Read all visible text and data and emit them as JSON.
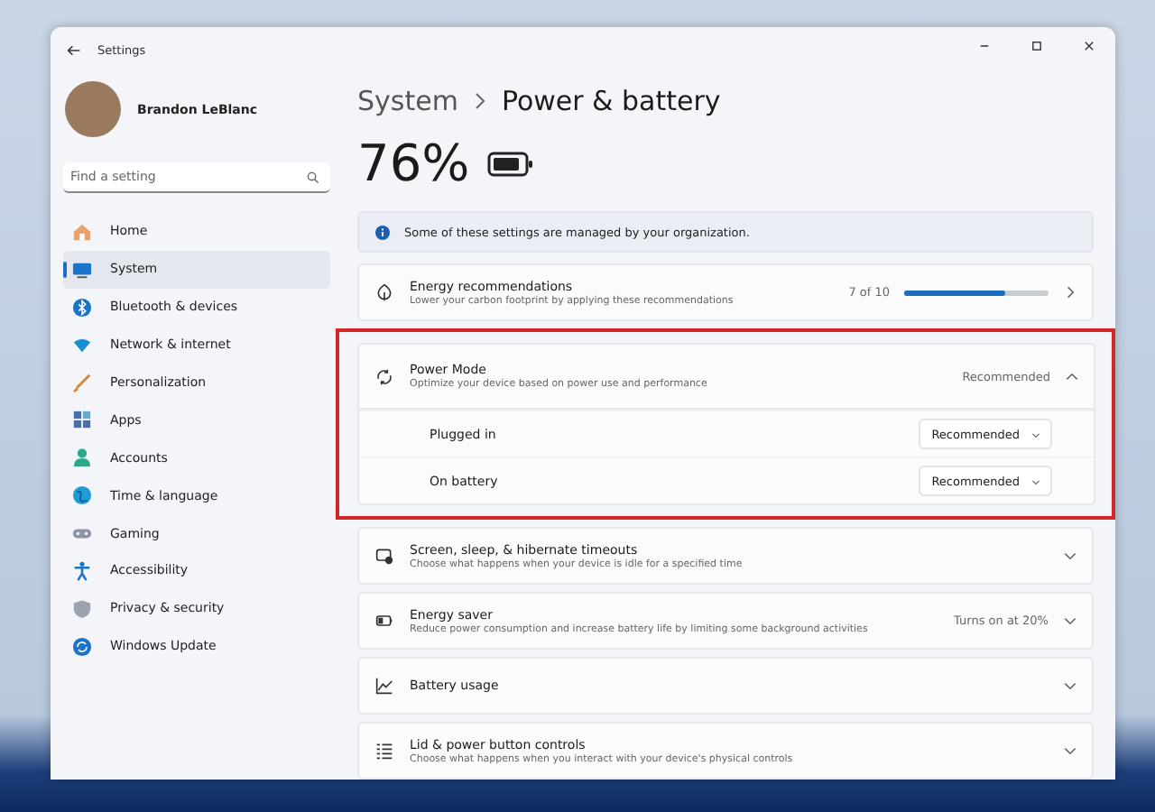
{
  "window": {
    "title": "Settings"
  },
  "user": {
    "name": "Brandon LeBlanc"
  },
  "search": {
    "placeholder": "Find a setting"
  },
  "nav": [
    {
      "label": "Home",
      "selected": false
    },
    {
      "label": "System",
      "selected": true
    },
    {
      "label": "Bluetooth & devices",
      "selected": false
    },
    {
      "label": "Network & internet",
      "selected": false
    },
    {
      "label": "Personalization",
      "selected": false
    },
    {
      "label": "Apps",
      "selected": false
    },
    {
      "label": "Accounts",
      "selected": false
    },
    {
      "label": "Time & language",
      "selected": false
    },
    {
      "label": "Gaming",
      "selected": false
    },
    {
      "label": "Accessibility",
      "selected": false
    },
    {
      "label": "Privacy & security",
      "selected": false
    },
    {
      "label": "Windows Update",
      "selected": false
    }
  ],
  "breadcrumb": {
    "parent": "System",
    "current": "Power & battery"
  },
  "battery": {
    "percent": "76%"
  },
  "notice": {
    "text": "Some of these settings are managed by your organization."
  },
  "settings": [
    {
      "kind": "progress",
      "title": "Energy recommendations",
      "subtitle": "Lower your carbon footprint by applying these recommendations",
      "reading": "7 of 10",
      "level": 0.7
    },
    {
      "kind": "expander",
      "title": "Power Mode",
      "subtitle": "Optimize your device based on power use and performance",
      "value": "Recommended",
      "expanded": true,
      "highlighted": true,
      "rows": [
        {
          "label": "Plugged in",
          "value": "Recommended"
        },
        {
          "label": "On battery",
          "value": "Recommended"
        }
      ]
    },
    {
      "kind": "expander",
      "title": "Screen, sleep, & hibernate timeouts",
      "subtitle": "Choose what happens when your device is idle for a specified time",
      "expanded": false,
      "highlighted": false
    },
    {
      "kind": "expander",
      "title": "Energy saver",
      "subtitle": "Reduce power consumption and increase battery life by limiting some background activities",
      "value": "Turns on at 20%",
      "expanded": false,
      "highlighted": false
    },
    {
      "kind": "expander",
      "title": "Battery usage",
      "expanded": false,
      "highlighted": false
    },
    {
      "kind": "expander",
      "title": "Lid & power button controls",
      "subtitle": "Choose what happens when you interact with your device's physical controls",
      "expanded": false,
      "highlighted": false
    }
  ]
}
